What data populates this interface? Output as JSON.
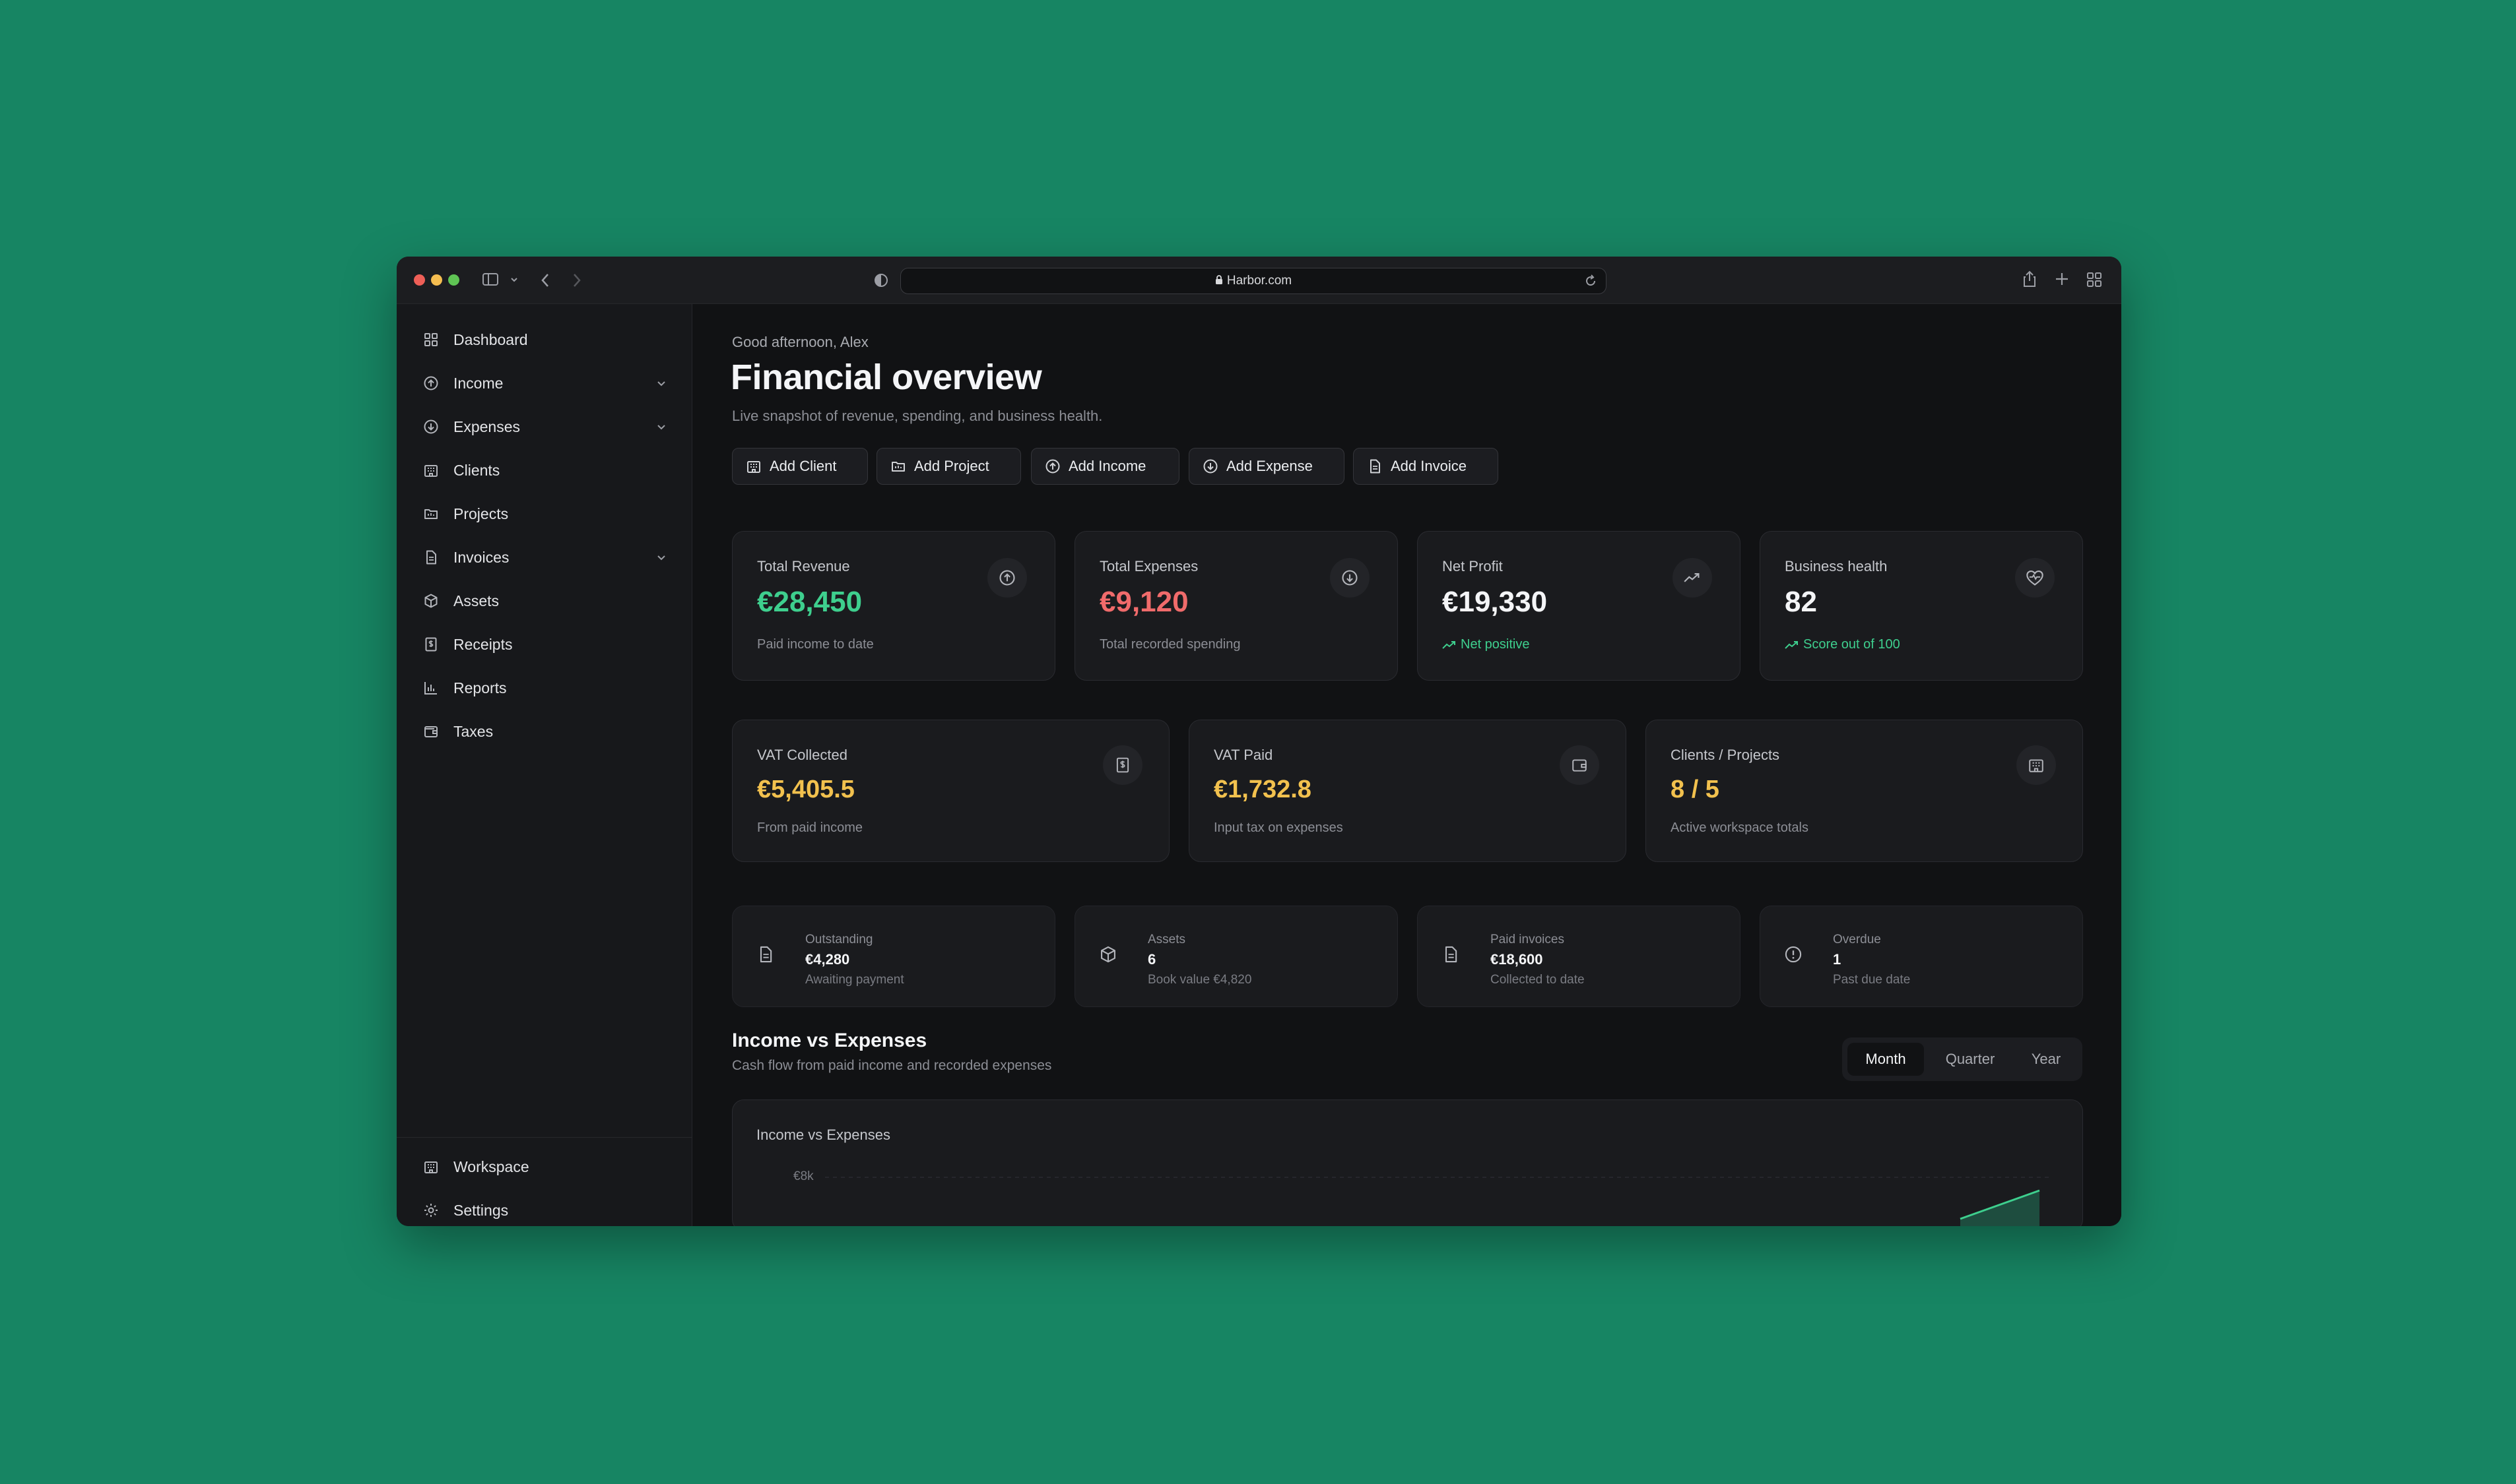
{
  "browser": {
    "url": "Harbor.com",
    "colors": {
      "close": "#ee5f57",
      "minimize": "#f4bd50",
      "maximize": "#5fc454"
    }
  },
  "sidebar": {
    "items": [
      {
        "label": "Dashboard",
        "icon": "dashboard-icon",
        "expandable": false
      },
      {
        "label": "Income",
        "icon": "arrow-up-circle-icon",
        "expandable": true
      },
      {
        "label": "Expenses",
        "icon": "arrow-down-circle-icon",
        "expandable": true
      },
      {
        "label": "Clients",
        "icon": "building-icon",
        "expandable": false
      },
      {
        "label": "Projects",
        "icon": "folder-icon",
        "expandable": false
      },
      {
        "label": "Invoices",
        "icon": "document-icon",
        "expandable": true
      },
      {
        "label": "Assets",
        "icon": "box-icon",
        "expandable": false
      },
      {
        "label": "Receipts",
        "icon": "receipt-icon",
        "expandable": false
      },
      {
        "label": "Reports",
        "icon": "bar-chart-icon",
        "expandable": false
      },
      {
        "label": "Taxes",
        "icon": "wallet-icon",
        "expandable": false
      }
    ],
    "footer": [
      {
        "label": "Workspace",
        "icon": "building-icon"
      },
      {
        "label": "Settings",
        "icon": "gear-icon"
      }
    ]
  },
  "header": {
    "greeting": "Good afternoon, Alex",
    "title": "Financial overview",
    "subtitle": "Live snapshot of revenue, spending, and business health."
  },
  "actions": [
    {
      "label": "Add Client",
      "icon": "building-icon"
    },
    {
      "label": "Add Project",
      "icon": "folder-icon"
    },
    {
      "label": "Add Income",
      "icon": "arrow-up-circle-icon"
    },
    {
      "label": "Add Expense",
      "icon": "arrow-down-circle-icon"
    },
    {
      "label": "Add Invoice",
      "icon": "document-icon"
    }
  ],
  "stats": [
    {
      "label": "Total Revenue",
      "value": "€28,450",
      "sub": "Paid income to date",
      "color": "#3ecf8e",
      "icon": "arrow-up-circle-icon"
    },
    {
      "label": "Total Expenses",
      "value": "€9,120",
      "sub": "Total recorded spending",
      "color": "#f06b6b",
      "icon": "arrow-down-circle-icon"
    },
    {
      "label": "Net Profit",
      "value": "€19,330",
      "sub": "Net positive",
      "color": "#f4f5f7",
      "sub_color": "#3ecf8e",
      "icon": "trending-up-icon"
    },
    {
      "label": "Business health",
      "value": "82",
      "sub": "Score out of 100",
      "color": "#f4f5f7",
      "sub_color": "#3ecf8e",
      "icon": "heart-pulse-icon"
    }
  ],
  "vat": [
    {
      "label": "VAT Collected",
      "value": "€5,405.5",
      "sub": "From paid income",
      "color": "#f2c14e",
      "icon": "receipt-icon"
    },
    {
      "label": "VAT Paid",
      "value": "€1,732.8",
      "sub": "Input tax on expenses",
      "color": "#f2c14e",
      "icon": "wallet-icon"
    },
    {
      "label": "Clients / Projects",
      "value": "8 / 5",
      "sub": "Active workspace totals",
      "color": "#f2c14e",
      "icon": "building-icon"
    }
  ],
  "mini": [
    {
      "label": "Outstanding",
      "value": "€4,280",
      "sub": "Awaiting payment",
      "icon": "document-icon"
    },
    {
      "label": "Assets",
      "value": "6",
      "sub": "Book value €4,820",
      "icon": "box-icon"
    },
    {
      "label": "Paid invoices",
      "value": "€18,600",
      "sub": "Collected to date",
      "icon": "document-icon"
    },
    {
      "label": "Overdue",
      "value": "1",
      "sub": "Past due date",
      "icon": "alert-circle-icon"
    }
  ],
  "cashflow": {
    "title": "Income vs Expenses",
    "subtitle": "Cash flow from paid income and recorded expenses",
    "periods": [
      "Month",
      "Quarter",
      "Year"
    ],
    "active_period": "Month",
    "chart_title": "Income vs Expenses",
    "tick_top": "€8k",
    "accent": "#3ecf8e"
  }
}
